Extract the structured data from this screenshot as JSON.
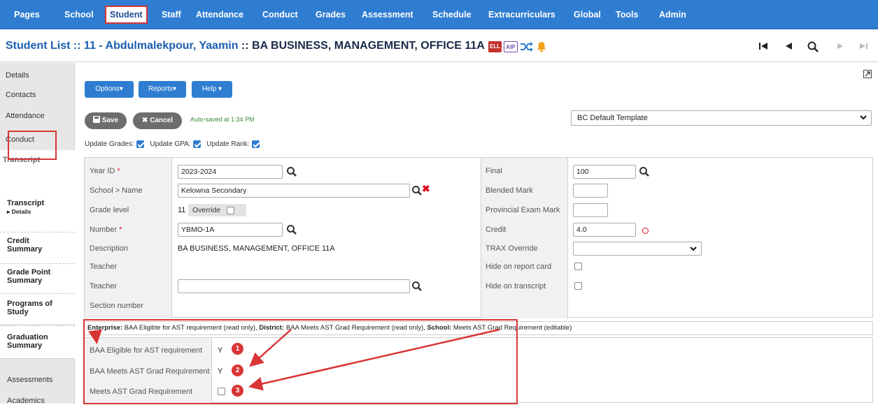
{
  "nav": {
    "items": [
      "Pages",
      "School",
      "Student",
      "Staff",
      "Attendance",
      "Conduct",
      "Grades",
      "Assessment",
      "Schedule",
      "Extracurriculars",
      "Global",
      "Tools",
      "Admin"
    ],
    "active": "Student"
  },
  "title": {
    "prefix": "Student List :: 11 - Abdulmalekpour, Yaamin",
    "rest": " :: BA BUSINESS, MANAGEMENT, OFFICE 11A",
    "ell_badge": "ELL",
    "aip_badge": "AIP"
  },
  "sidebar": {
    "tabs_top": [
      "Details",
      "Contacts",
      "Attendance",
      "Conduct",
      "Transcript"
    ],
    "sub_items": [
      {
        "l1": "Transcript",
        "l2": "▸ Details"
      },
      {
        "l1": "Credit",
        "l2": "Summary"
      },
      {
        "l1": "Grade Point",
        "l2": "Summary"
      },
      {
        "l1": "Programs of",
        "l2": "Study"
      },
      {
        "l1": "Graduation",
        "l2": "Summary"
      }
    ],
    "tabs_bottom": [
      "Assessments",
      "Academics"
    ]
  },
  "toolbar": {
    "options": "Options▾",
    "reports": "Reports▾",
    "help": "Help ▾",
    "save": "Save",
    "cancel": "Cancel",
    "autosaved": "Auto-saved at 1:34 PM",
    "template": "BC Default Template"
  },
  "updates": {
    "grades": "Update Grades:",
    "gpa": "Update GPA:",
    "rank": "Update Rank:"
  },
  "form": {
    "left": {
      "year_id_label": "Year ID",
      "year_id_value": "2023-2024",
      "school_label": "School > Name",
      "school_value": "Kelowna Secondary",
      "grade_label": "Grade level",
      "grade_value": "11",
      "override_label": "Override",
      "number_label": "Number",
      "number_value": "YBMO-1A",
      "desc_label": "Description",
      "desc_value": "BA BUSINESS, MANAGEMENT, OFFICE 11A",
      "teacher_label1": "Teacher",
      "teacher_label2": "Teacher",
      "section_label": "Section number",
      "req_mark": "*"
    },
    "right": {
      "final_label": "Final",
      "final_value": "100",
      "blended_label": "Blended Mark",
      "prov_label": "Provincial Exam Mark",
      "credit_label": "Credit",
      "credit_value": "4.0",
      "trax_label": "TRAX Override",
      "hide_report_label": "Hide on report card",
      "hide_transcript_label": "Hide on transcript"
    }
  },
  "infobar": {
    "enterprise_key": "Enterprise:",
    "enterprise_val": " BAA Eligible for AST requirement (read only), ",
    "district_key": "District:",
    "district_val": " BAA Meets AST Grad Requirement (read only), ",
    "school_key": "School:",
    "school_val": " Meets AST Grad Requirement (editable)"
  },
  "ast": {
    "eligible_label": "BAA Eligible for AST requirement",
    "eligible_value": "Y",
    "meets_label": "BAA Meets AST Grad Requirement",
    "meets_value": "Y",
    "school_label": "Meets AST Grad Requirement",
    "n1": "1",
    "n2": "2",
    "n3": "3"
  },
  "colors": {
    "nav_blue": "#2f7dd1",
    "annotation_red": "#d93535",
    "title_blue": "#1b5fb0"
  }
}
